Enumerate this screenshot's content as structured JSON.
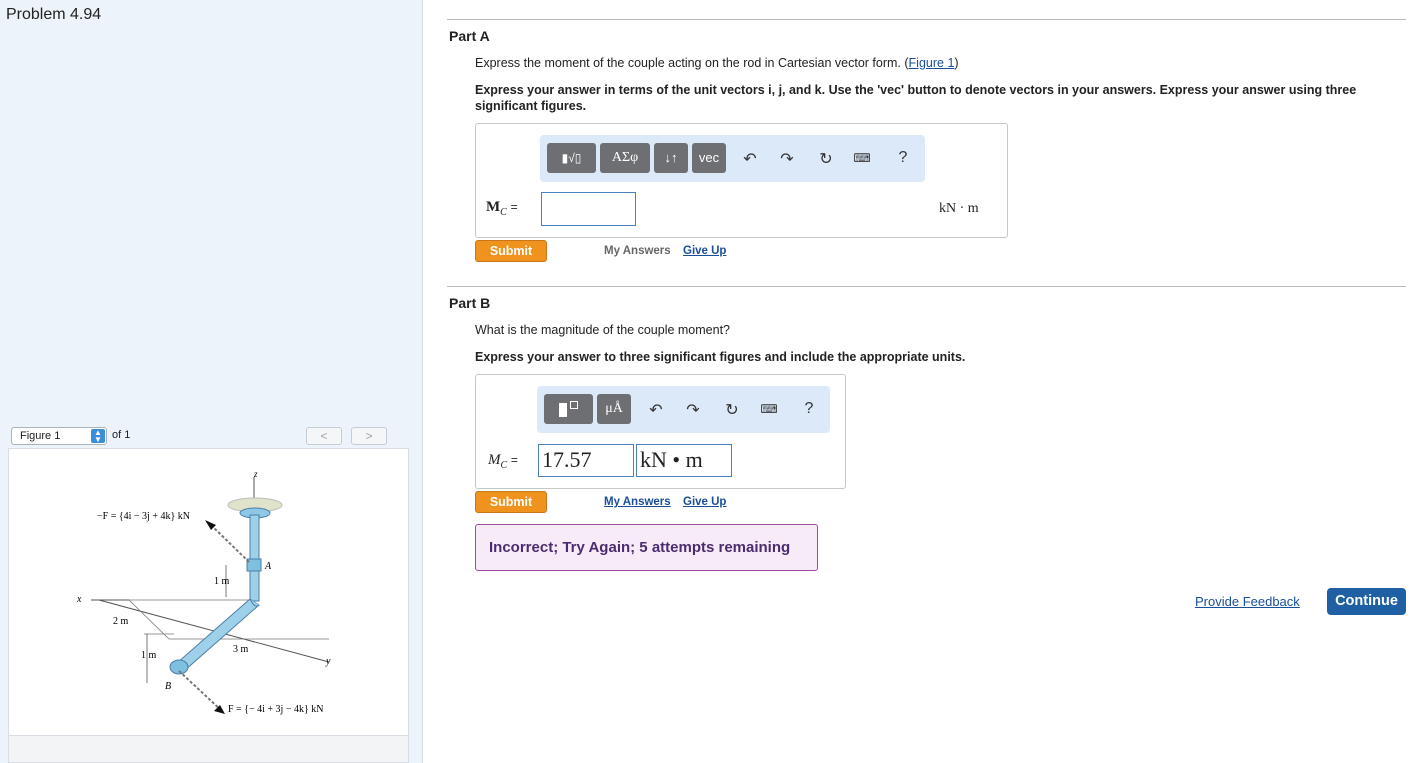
{
  "problem": {
    "title": "Problem 4.94"
  },
  "figure_nav": {
    "selected": "Figure 1",
    "of_label": "of 1",
    "prev": "<",
    "next": ">"
  },
  "figure": {
    "z_label": "z",
    "x_label": "x",
    "y_label": "y",
    "a_label": "A",
    "b_label": "B",
    "neg_force": "−F = {4i − 3j + 4k} kN",
    "force": "F = {− 4i + 3j − 4k} kN",
    "dim_1m_top": "1 m",
    "dim_2m": "2 m",
    "dim_1m_bottom": "1 m",
    "dim_3m": "3 m"
  },
  "part_a": {
    "title": "Part A",
    "question_prefix": "Express the moment of the couple acting on the rod in Cartesian vector form. (",
    "figure_link": "Figure 1",
    "question_suffix": ")",
    "instruction": "Express your answer in terms of the unit vectors i, j, and k. Use the 'vec' button to denote vectors in your answers. Express your answer using three significant figures.",
    "toolbar": {
      "templates": "▮√▯",
      "greek": "ΑΣφ",
      "arrows": "↓↑",
      "vec": "vec",
      "help": "?"
    },
    "variable": "M",
    "subscript": "C",
    "equals": "=",
    "value": "",
    "units": "kN · m",
    "submit": "Submit",
    "my_answers": "My Answers",
    "give_up": "Give Up"
  },
  "part_b": {
    "title": "Part B",
    "question": "What is the magnitude of the couple moment?",
    "instruction": "Express your answer to three significant figures and include the appropriate units.",
    "toolbar": {
      "units": "μÅ",
      "help": "?"
    },
    "variable": "M",
    "subscript": "C",
    "equals": "=",
    "value": "17.57",
    "units_value": "kN • m",
    "submit": "Submit",
    "my_answers": "My Answers",
    "give_up": "Give Up",
    "feedback": "Incorrect; Try Again; 5 attempts remaining"
  },
  "footer": {
    "provide_feedback": "Provide Feedback",
    "continue": "Continue"
  },
  "colors": {
    "submit": "#f0921e",
    "continue": "#1f5fa3",
    "link": "#1a4e9a",
    "feedback_bg": "#f8ebf8",
    "panel_bg": "#edf3fa",
    "toolbar_bg": "#dbe9f9"
  }
}
